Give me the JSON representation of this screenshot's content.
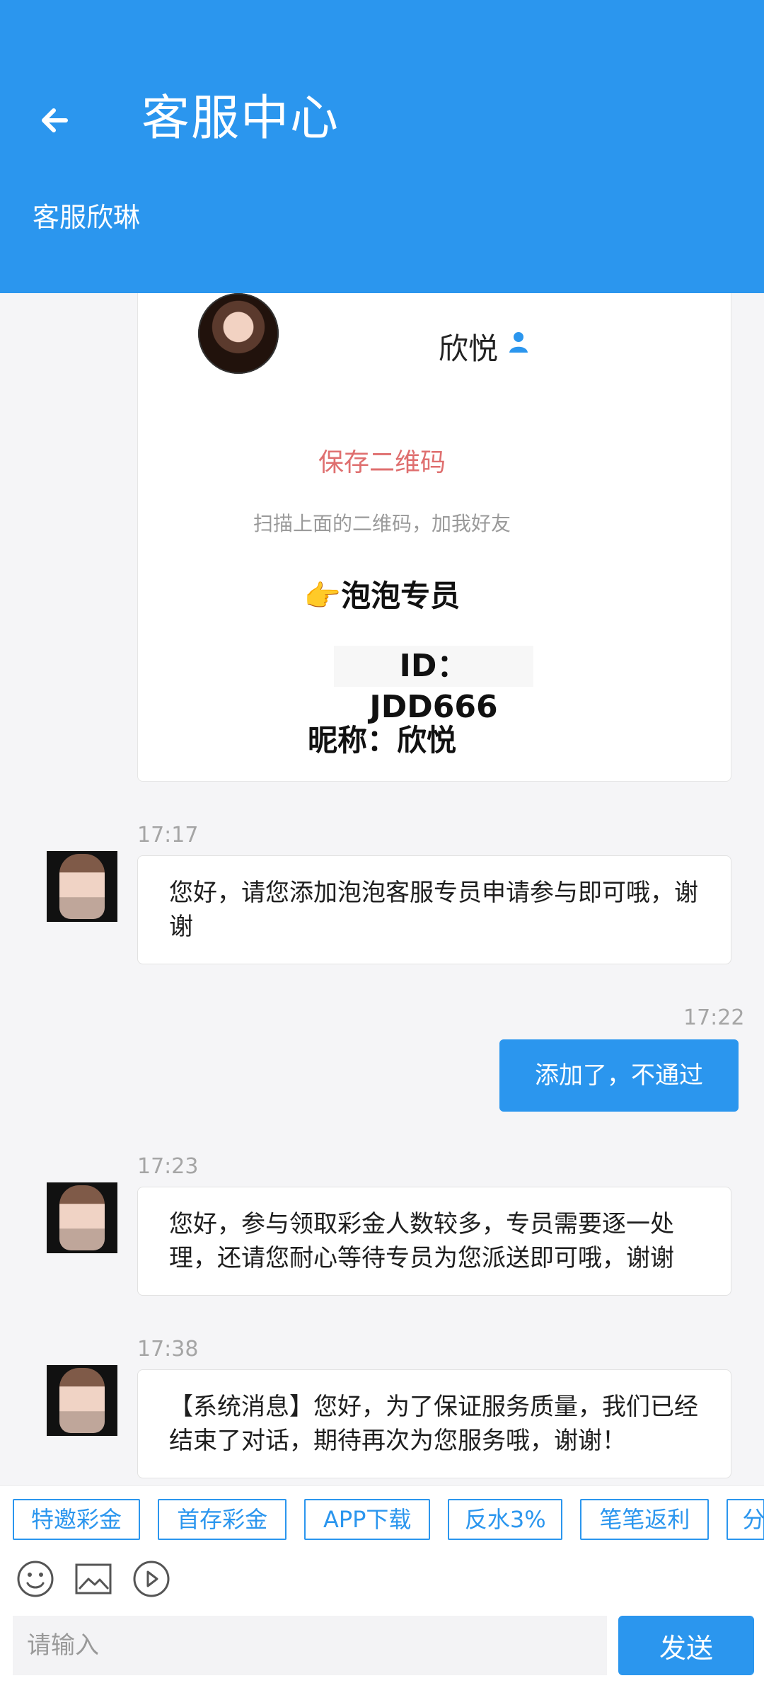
{
  "header": {
    "title": "客服中心",
    "agent_name": "客服欣琳"
  },
  "profile_card": {
    "name": "欣悦",
    "save_qr": "保存二维码",
    "scan_text": "扫描上面的二维码，加我好友",
    "title_line": "👉泡泡专员",
    "id_line": "ID： JDD666",
    "nickname_line": "昵称：欣悦"
  },
  "messages": [
    {
      "time": "17:17",
      "text": "您好，请您添加泡泡客服专员申请参与即可哦，谢谢"
    },
    {
      "time": "17:22",
      "text": "添加了，不通过"
    },
    {
      "time": "17:23",
      "text": "您好，参与领取彩金人数较多，专员需要逐一处理，还请您耐心等待专员为您派送即可哦，谢谢"
    },
    {
      "time": "17:38",
      "text": "【系统消息】您好，为了保证服务质量，我们已经结束了对话，期待再次为您服务哦，谢谢！"
    }
  ],
  "quick_tags": [
    "特邀彩金",
    "首存彩金",
    "APP下载",
    "反水3%",
    "笔笔返利",
    "分"
  ],
  "composer": {
    "placeholder": "请输入",
    "send_label": "发送"
  },
  "icons": {
    "back": "back-arrow-icon",
    "emoji": "emoji-icon",
    "image": "image-icon",
    "video": "video-play-icon",
    "profile": "person-icon"
  },
  "colors": {
    "primary": "#2b96ee",
    "save_qr": "#df6f6f"
  }
}
